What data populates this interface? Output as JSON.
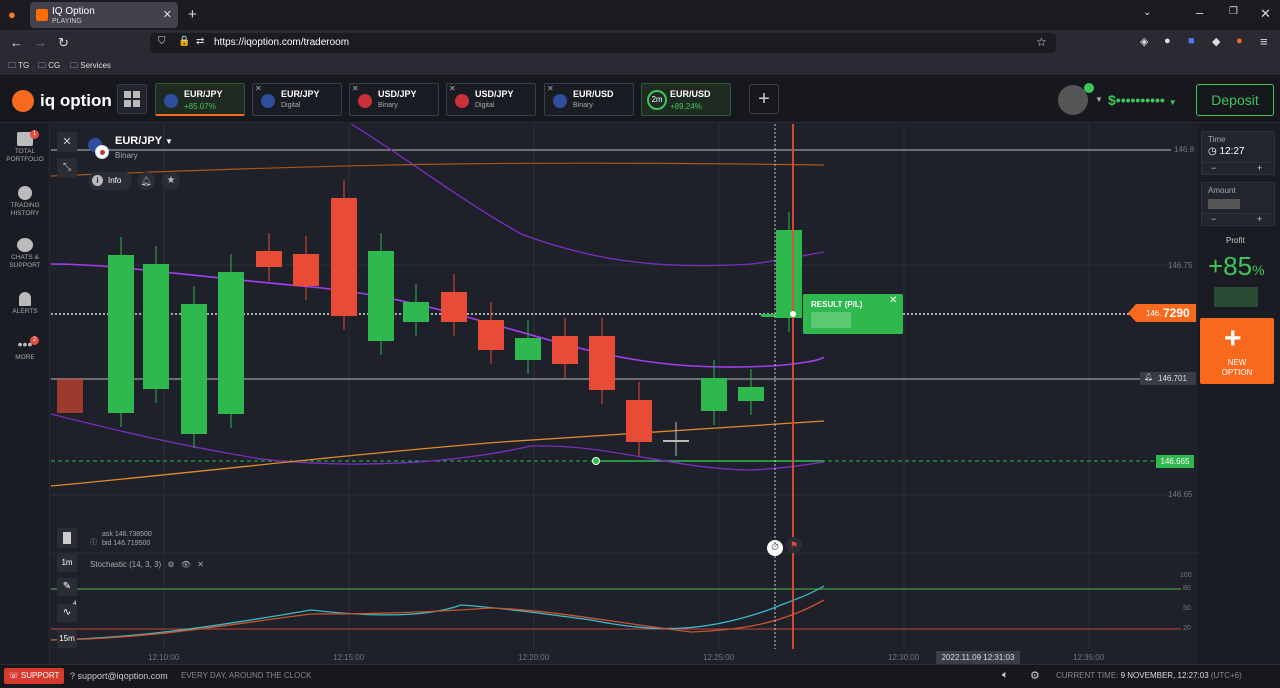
{
  "browser": {
    "tab_title": "IQ Option",
    "tab_subtitle": "PLAYING",
    "url": "https://iqoption.com/traderoom",
    "bookmarks": [
      "TG",
      "CG",
      "Services"
    ]
  },
  "header": {
    "logo": "iq option",
    "assets": [
      {
        "name": "EUR/JPY",
        "sub": "+85.07%",
        "active": true
      },
      {
        "name": "EUR/JPY",
        "sub": "Digital",
        "active": false
      },
      {
        "name": "USD/JPY",
        "sub": "Binary",
        "active": false
      },
      {
        "name": "USD/JPY",
        "sub": "Digital",
        "active": false
      },
      {
        "name": "EUR/USD",
        "sub": "Binary",
        "active": false
      },
      {
        "name": "EUR/USD",
        "sub": "+89.24%",
        "active": false,
        "timer": "2m"
      }
    ],
    "balance": "$••••••••••",
    "deposit_label": "Deposit"
  },
  "sidebar": {
    "items": [
      {
        "label1": "TOTAL",
        "label2": "PORTFOLIO",
        "badge": "1"
      },
      {
        "label1": "TRADING",
        "label2": "HISTORY",
        "badge": ""
      },
      {
        "label1": "CHATS &",
        "label2": "SUPPORT",
        "badge": ""
      },
      {
        "label1": "ALERTS",
        "label2": "",
        "badge": ""
      },
      {
        "label1": "MORE",
        "label2": "",
        "badge": "2"
      }
    ]
  },
  "chart_header": {
    "asset": "EUR/JPY",
    "type": "Binary",
    "info_label": "Info",
    "ask": "ask 146.738500",
    "bid": "bid 146.719500",
    "timeframe": "1m",
    "timeframe2": "15m",
    "indicator_badge": "4"
  },
  "price_labels": {
    "top": "146.8",
    "l75": "146.75",
    "current_prefix": "146.",
    "current_suffix": "7290",
    "line_701": "146.701",
    "green_665": "146.665",
    "l65": "146.65"
  },
  "result": {
    "title": "RESULT (P/L)"
  },
  "stochastic": {
    "label": "Stochastic (14, 3, 3)",
    "levels": [
      "100",
      "80",
      "50",
      "20"
    ]
  },
  "time_axis": [
    "12:10:00",
    "12:15:00",
    "12:20:00",
    "12:25:00",
    "12:30:00",
    "12:35:00"
  ],
  "crosshair_time": "2022.11.09 12:31:03",
  "right_panel": {
    "time_label": "Time",
    "time_value": "12:27",
    "amount_label": "Amount",
    "profit_label": "Profit",
    "profit_value": "+85",
    "profit_unit": "%",
    "new_option_1": "NEW",
    "new_option_2": "OPTION"
  },
  "footer": {
    "support_label": "SUPPORT",
    "email": "support@iqoption.com",
    "hours": "EVERY DAY, AROUND THE CLOCK",
    "current_time_label": "CURRENT TIME:",
    "current_time_value": "9 NOVEMBER, 12:27:03",
    "tz": "(UTC+6)"
  },
  "colors": {
    "up": "#2eb84d",
    "down": "#e84b36",
    "accent": "#f76a1e",
    "bollinger": "#a33ef2",
    "ma": "#e08a2a"
  }
}
